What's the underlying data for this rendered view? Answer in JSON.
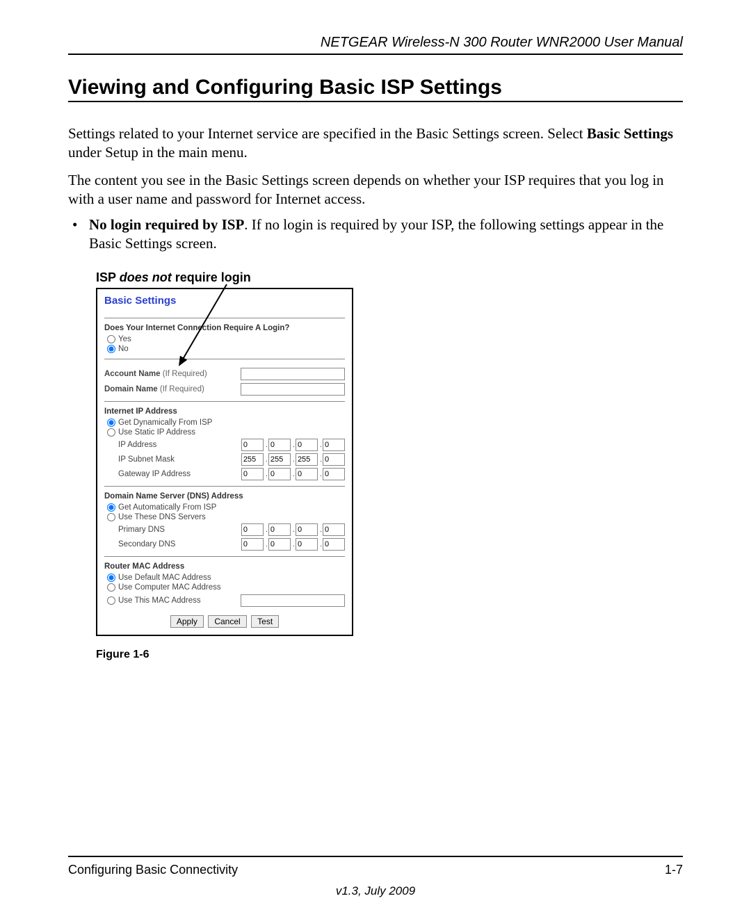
{
  "header": {
    "title": "NETGEAR Wireless-N 300 Router WNR2000 User Manual"
  },
  "section": {
    "title": "Viewing and Configuring Basic ISP Settings",
    "para1_a": "Settings related to your Internet service are specified in the Basic Settings screen. Select ",
    "para1_b_bold": "Basic Settings",
    "para1_c": " under Setup in the main menu.",
    "para2": "The content you see in the Basic Settings screen depends on whether your ISP requires that you log in with a user name and password for Internet access.",
    "bullet1_bold": "No login required by ISP",
    "bullet1_rest": ". If no login is required by your ISP, the following settings appear in the Basic Settings screen."
  },
  "callout": {
    "pre": "ISP ",
    "em": "does not",
    "post": " require login"
  },
  "screenshot": {
    "title": "Basic Settings",
    "login": {
      "question": "Does Your Internet Connection Require A Login?",
      "yes": "Yes",
      "no": "No"
    },
    "account": {
      "account_label": "Account Name",
      "domain_label": "Domain Name",
      "if_required": "(If Required)"
    },
    "ip": {
      "title": "Internet IP Address",
      "dyn": "Get Dynamically From ISP",
      "static": "Use Static IP Address",
      "ip_addr": "IP Address",
      "subnet": "IP Subnet Mask",
      "gateway": "Gateway IP Address",
      "ip_vals": [
        "0",
        "0",
        "0",
        "0"
      ],
      "subnet_vals": [
        "255",
        "255",
        "255",
        "0"
      ],
      "gateway_vals": [
        "0",
        "0",
        "0",
        "0"
      ]
    },
    "dns": {
      "title": "Domain Name Server (DNS) Address",
      "auto": "Get Automatically From ISP",
      "use": "Use These DNS Servers",
      "primary": "Primary DNS",
      "secondary": "Secondary DNS",
      "primary_vals": [
        "0",
        "0",
        "0",
        "0"
      ],
      "secondary_vals": [
        "0",
        "0",
        "0",
        "0"
      ]
    },
    "mac": {
      "title": "Router MAC Address",
      "def": "Use Default MAC Address",
      "comp": "Use Computer MAC Address",
      "this": "Use This MAC Address"
    },
    "buttons": {
      "apply": "Apply",
      "cancel": "Cancel",
      "test": "Test"
    }
  },
  "figure": "Figure 1-6",
  "footer": {
    "left": "Configuring Basic Connectivity",
    "right": "1-7",
    "version": "v1.3, July 2009"
  }
}
